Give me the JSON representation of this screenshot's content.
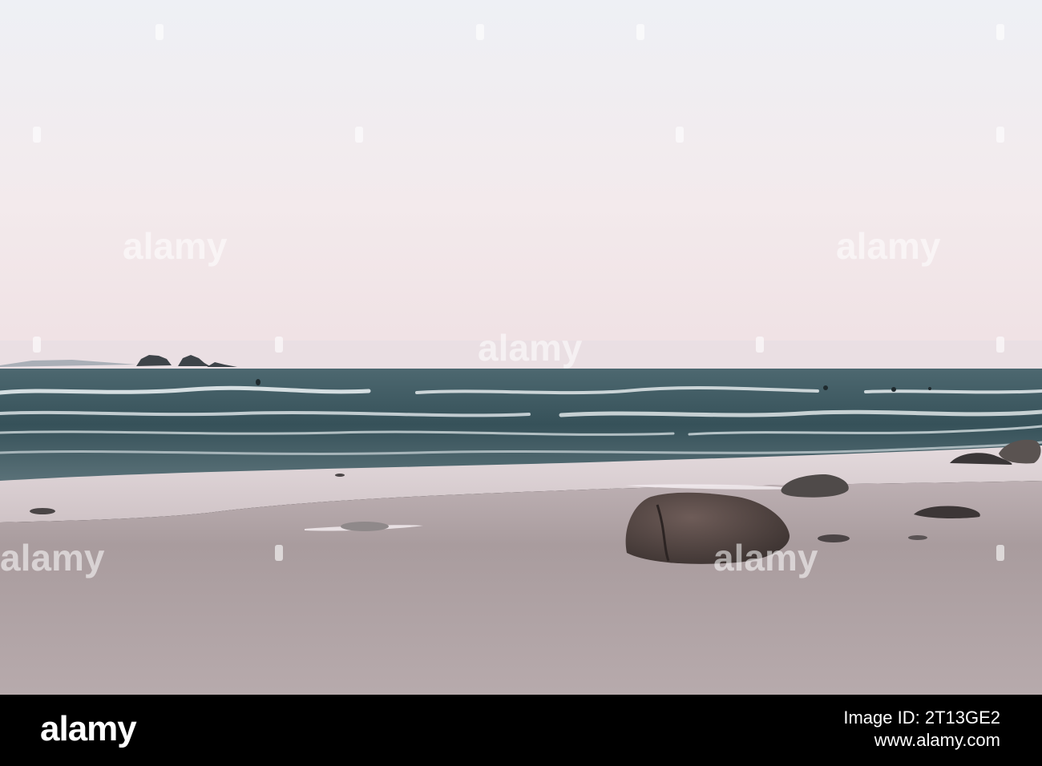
{
  "watermark": {
    "text": "alamy"
  },
  "footer": {
    "logo_text": "alamy",
    "image_id_label": "Image ID:",
    "image_id": "2T13GE2",
    "site": "www.alamy.com"
  },
  "colors": {
    "sky_top": "#eef0f4",
    "sky_horizon": "#f1e3e6",
    "sea_dark": "#2f4a52",
    "sea_foam": "#dde3e6",
    "sand": "#b0a4a6",
    "rock": "#4a3f3e",
    "footer_bg": "#000000"
  }
}
